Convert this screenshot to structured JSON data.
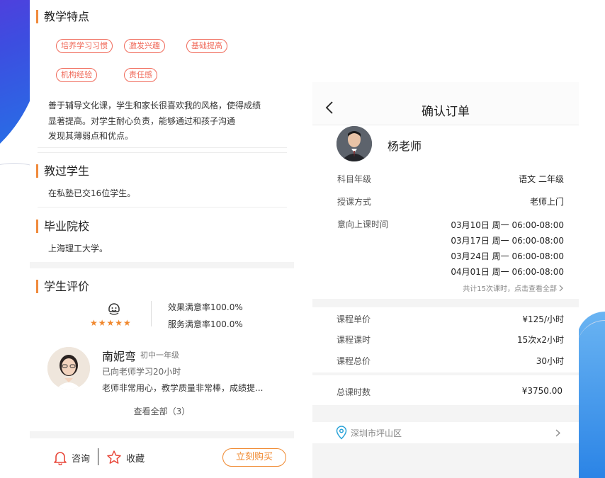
{
  "teacher_profile": {
    "teaching_features": {
      "title": "教学特点",
      "tags": [
        "培养学习习惯",
        "激发兴趣",
        "基础提高",
        "机构经验",
        "责任感"
      ],
      "description_lines": [
        "善于辅导文化课，学生和家长很喜欢我的风格，使得成绩",
        "显著提高。对学生耐心负责，能够通过和孩子沟通",
        "发现其薄弱点和优点。"
      ]
    },
    "students_taught": {
      "title": "教过学生",
      "text": "在私塾已交16位学生。"
    },
    "graduated_school": {
      "title": "毕业院校",
      "text": "上海理工大学。"
    }
  },
  "reviews": {
    "title": "学生评价",
    "stars": "★★★★★",
    "effect_rate": "效果满意率100.0%",
    "service_rate": "服务满意率100.0%",
    "reviewer": {
      "name": "南妮弯",
      "grade": "初中一年级",
      "duration": "已向老师学习20小时",
      "comment": "老师非常用心，教学质量非常棒，成绩提..."
    },
    "view_all": "查看全部（3）"
  },
  "bottom_bar": {
    "consult_label": "咨询",
    "favorite_label": "收藏",
    "buy_label": "立刻购买"
  },
  "order": {
    "header_title": "确认订单",
    "teacher_name": "杨老师",
    "subject_label": "科目年级",
    "subject_value": "语文 二年级",
    "mode_label": "授课方式",
    "mode_value": "老师上门",
    "time_label": "意向上课时间",
    "times": [
      "03月10日 周一 06:00-08:00",
      "03月17日 周一 06:00-08:00",
      "03月24日 周一 06:00-08:00",
      "04月01日 周一 06:00-08:00"
    ],
    "time_summary": "共计15次课时，点击查看全部",
    "unit_price_label": "课程单价",
    "unit_price_value": "¥125/小时",
    "hours_label": "课程课时",
    "hours_value": "15次x2小时",
    "total_price_label": "课程总价",
    "total_price_value": "30小时",
    "total_hours_label": "总课时数",
    "total_hours_value": "¥3750.00",
    "address": "深圳市坪山区"
  },
  "colors": {
    "accent_orange": "#f08a3c",
    "tag_red": "#f06a5a",
    "location_blue": "#2aa3d8"
  }
}
